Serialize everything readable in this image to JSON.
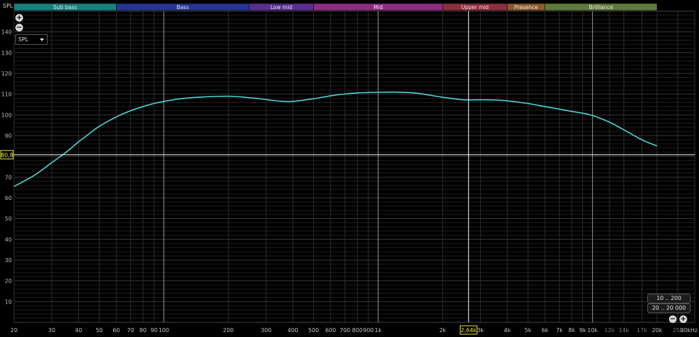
{
  "chart_data": {
    "type": "line",
    "y_axis_label": "SPL",
    "y_ticks": [
      10,
      20,
      30,
      40,
      50,
      60,
      70,
      80,
      90,
      100,
      110,
      120,
      130,
      140
    ],
    "ylim": [
      0,
      150
    ],
    "x_scale": "log",
    "xlim": [
      20,
      30000
    ],
    "x_ticks": [
      {
        "v": 20,
        "t": "20"
      },
      {
        "v": 30,
        "t": "30"
      },
      {
        "v": 40,
        "t": "40"
      },
      {
        "v": 50,
        "t": "50"
      },
      {
        "v": 60,
        "t": "60"
      },
      {
        "v": 70,
        "t": "70"
      },
      {
        "v": 80,
        "t": "80"
      },
      {
        "v": 90,
        "t": "90"
      },
      {
        "v": 100,
        "t": "100"
      },
      {
        "v": 200,
        "t": "200"
      },
      {
        "v": 300,
        "t": "300"
      },
      {
        "v": 400,
        "t": "400"
      },
      {
        "v": 500,
        "t": "500"
      },
      {
        "v": 600,
        "t": "600"
      },
      {
        "v": 700,
        "t": "700"
      },
      {
        "v": 800,
        "t": "800"
      },
      {
        "v": 900,
        "t": "900"
      },
      {
        "v": 1000,
        "t": "1k"
      },
      {
        "v": 2000,
        "t": "2k"
      },
      {
        "v": 3000,
        "t": "3k"
      },
      {
        "v": 4000,
        "t": "4k"
      },
      {
        "v": 5000,
        "t": "5k"
      },
      {
        "v": 6000,
        "t": "6k"
      },
      {
        "v": 7000,
        "t": "7k"
      },
      {
        "v": 8000,
        "t": "8k"
      },
      {
        "v": 9000,
        "t": "9k"
      },
      {
        "v": 10000,
        "t": "10k"
      },
      {
        "v": 12000,
        "t": "12k"
      },
      {
        "v": 14000,
        "t": "14k"
      },
      {
        "v": 17000,
        "t": "17k"
      },
      {
        "v": 20000,
        "t": "20k"
      },
      {
        "v": 25000,
        "t": "25k"
      },
      {
        "v": 30000,
        "t": "30kHz"
      }
    ],
    "major_x_lines": [
      100,
      1000,
      10000
    ],
    "bands": [
      {
        "label": "Sub bass",
        "from": 20,
        "to": 60,
        "color": "#1a7f7f"
      },
      {
        "label": "Bass",
        "from": 60,
        "to": 250,
        "color": "#26358f"
      },
      {
        "label": "Low mid",
        "from": 250,
        "to": 500,
        "color": "#5a2f8f"
      },
      {
        "label": "Mid",
        "from": 500,
        "to": 2000,
        "color": "#8c2f80"
      },
      {
        "label": "Upper mid",
        "from": 2000,
        "to": 4000,
        "color": "#8c2f3c"
      },
      {
        "label": "Presence",
        "from": 4000,
        "to": 6000,
        "color": "#8a5a30"
      },
      {
        "label": "Brilliance",
        "from": 6000,
        "to": 20000,
        "color": "#5f7a40"
      }
    ],
    "series": [
      {
        "color": "#4fd8d8",
        "points": [
          [
            20,
            65.5
          ],
          [
            25,
            71
          ],
          [
            30,
            77
          ],
          [
            35,
            82
          ],
          [
            40,
            87
          ],
          [
            45,
            91
          ],
          [
            50,
            94.5
          ],
          [
            60,
            99
          ],
          [
            70,
            102
          ],
          [
            80,
            104
          ],
          [
            90,
            105.5
          ],
          [
            100,
            106.5
          ],
          [
            120,
            107.8
          ],
          [
            150,
            108.6
          ],
          [
            200,
            109
          ],
          [
            250,
            108.3
          ],
          [
            300,
            107.4
          ],
          [
            350,
            106.6
          ],
          [
            400,
            106.5
          ],
          [
            500,
            107.8
          ],
          [
            600,
            109.2
          ],
          [
            700,
            110.1
          ],
          [
            800,
            110.6
          ],
          [
            900,
            110.8
          ],
          [
            1000,
            110.9
          ],
          [
            1200,
            111
          ],
          [
            1500,
            110.5
          ],
          [
            2000,
            108.5
          ],
          [
            2500,
            107.3
          ],
          [
            3000,
            107.3
          ],
          [
            3500,
            107.2
          ],
          [
            4000,
            106.8
          ],
          [
            5000,
            105.5
          ],
          [
            6000,
            104
          ],
          [
            7000,
            102.8
          ],
          [
            8000,
            101.7
          ],
          [
            9000,
            100.8
          ],
          [
            10000,
            99.7
          ],
          [
            12000,
            96.5
          ],
          [
            14000,
            92.8
          ],
          [
            17000,
            88
          ],
          [
            20000,
            85
          ]
        ]
      }
    ],
    "cursor": {
      "x": 2640,
      "y": 80.8,
      "x_label": "2,64k",
      "y_label": "80,8"
    }
  },
  "controls": {
    "spl_select": "SPL",
    "range_top": "10 .. 200",
    "range_bottom": "20 .. 20 000"
  },
  "colors": {
    "background": "#000000",
    "grid": "#2e2e2e",
    "grid_major": "#9a9a9a",
    "curve": "#4fd8d8",
    "cursor": "#ffffff",
    "cursor_label_bg": "#e8e84a"
  }
}
